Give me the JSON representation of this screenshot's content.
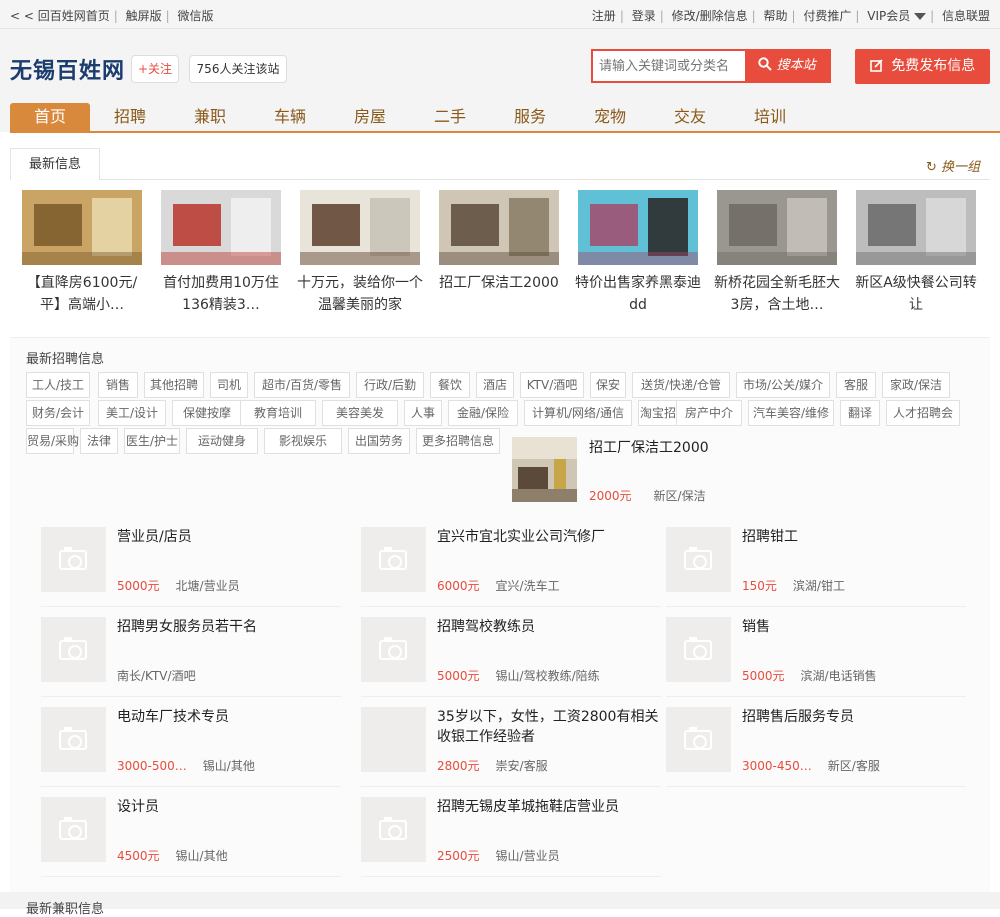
{
  "topbar": {
    "home_link": "< < 回百姓网首页",
    "touch_link": "触屏版",
    "wechat_link": "微信版",
    "register": "注册",
    "login": "登录",
    "edit": "修改/删除信息",
    "help": "帮助",
    "paid": "付费推广",
    "vip": "VIP会员",
    "alliance": "信息联盟"
  },
  "header": {
    "site_title": "无锡百姓网",
    "follow_label": "+关注",
    "follow_count": "756人关注该站",
    "search_placeholder": "请输入关键词或分类名",
    "search_button": "搜本站",
    "publish_button": "免费发布信息"
  },
  "nav": [
    "首页",
    "招聘",
    "兼职",
    "车辆",
    "房屋",
    "二手",
    "服务",
    "宠物",
    "交友",
    "培训"
  ],
  "latest": {
    "tab": "最新信息",
    "refresh": "换一组",
    "items": [
      {
        "title": "【直降房6100元/平】高端小…",
        "colors": [
          "#c9a465",
          "#7a5a2a",
          "#e8d7a8"
        ]
      },
      {
        "title": "首付加费用10万住136精装3…",
        "colors": [
          "#d9d9d9",
          "#b8342c",
          "#efefef"
        ]
      },
      {
        "title": "十万元，装给你一个温馨美丽的家",
        "colors": [
          "#e8e4da",
          "#5a3e2b",
          "#c8c3b7"
        ]
      },
      {
        "title": "招工厂保洁工2000",
        "colors": [
          "#cfc6b6",
          "#5b4a3a",
          "#8d7f6a"
        ]
      },
      {
        "title": "特价出售家养黑泰迪dd",
        "colors": [
          "#5fc0d6",
          "#a34a6d",
          "#2c2c2c"
        ]
      },
      {
        "title": "新桥花园全新毛胚大3房，含土地…",
        "colors": [
          "#9a9690",
          "#6e6a64",
          "#c5c1ba"
        ]
      },
      {
        "title": "新区A级快餐公司转让",
        "colors": [
          "#bdbdbd",
          "#6a6a6a",
          "#d9d9d9"
        ]
      }
    ]
  },
  "jobs": {
    "title": "最新招聘信息",
    "tags": [
      "工人/技工",
      "销售",
      "其他招聘",
      "司机",
      "超市/百货/零售",
      "行政/后勤",
      "餐饮",
      "酒店",
      "KTV/酒吧",
      "保安",
      "送货/快递/仓管",
      "市场/公关/媒介",
      "客服",
      "家政/保洁",
      "财务/会计",
      "美工/设计",
      "保健按摩",
      "教育培训",
      "美容美发",
      "人事",
      "金融/保险",
      "计算机/网络/通信",
      "淘宝招聘",
      "房产中介",
      "汽车美容/维修",
      "翻译",
      "人才招聘会",
      "贸易/采购",
      "法律",
      "医生/护士",
      "运动健身",
      "影视娱乐",
      "出国劳务",
      "更多招聘信息"
    ],
    "featured": {
      "title": "招工厂保洁工2000",
      "salary": "2000元",
      "area": "新区/保洁"
    },
    "listings": [
      {
        "title": "营业员/店员",
        "salary": "5000元",
        "area": "北塘/营业员",
        "photo": true
      },
      {
        "title": "宜兴市宜北实业公司汽修厂",
        "salary": "6000元",
        "area": "宜兴/洗车工",
        "photo": true
      },
      {
        "title": "招聘钳工",
        "salary": "150元",
        "area": "滨湖/钳工",
        "photo": true
      },
      {
        "title": "招聘男女服务员若干名",
        "salary": "",
        "area": "南长/KTV/酒吧",
        "photo": true
      },
      {
        "title": "招聘驾校教练员",
        "salary": "5000元",
        "area": "锡山/驾校教练/陪练",
        "photo": true
      },
      {
        "title": "销售",
        "salary": "5000元",
        "area": "滨湖/电话销售",
        "photo": true
      },
      {
        "title": "电动车厂技术专员",
        "salary": "3000-500…",
        "area": "锡山/其他",
        "photo": true
      },
      {
        "title": "35岁以下，女性，工资2800有相关收银工作经验者",
        "salary": "2800元",
        "area": "崇安/客服",
        "photo": false
      },
      {
        "title": "招聘售后服务专员",
        "salary": "3000-450…",
        "area": "新区/客服",
        "photo": true
      },
      {
        "title": "设计员",
        "salary": "4500元",
        "area": "锡山/其他",
        "photo": true
      },
      {
        "title": "招聘无锡皮革城拖鞋店营业员",
        "salary": "2500元",
        "area": "锡山/营业员",
        "photo": true
      }
    ]
  },
  "bottom_section": "最新兼职信息",
  "colors": {
    "accent": "#e84c3d",
    "nav": "#d8893b",
    "brand": "#1a3c6e"
  }
}
